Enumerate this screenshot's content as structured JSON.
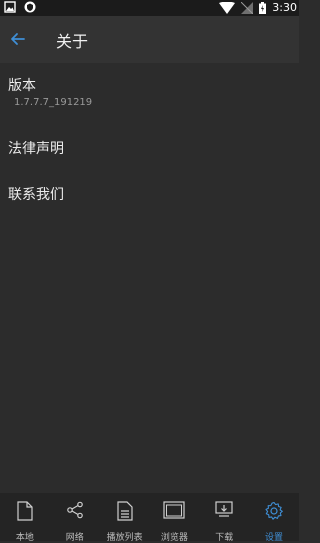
{
  "status_bar": {
    "time": "3:30"
  },
  "header": {
    "title": "关于"
  },
  "items": [
    {
      "title": "版本",
      "subtitle": "1.7.7.7_191219"
    },
    {
      "title": "法律声明"
    },
    {
      "title": "联系我们"
    }
  ],
  "bottom_nav": [
    {
      "label": "本地",
      "icon": "file-icon"
    },
    {
      "label": "网络",
      "icon": "share-icon"
    },
    {
      "label": "播放列表",
      "icon": "list-icon"
    },
    {
      "label": "浏览器",
      "icon": "browser-icon"
    },
    {
      "label": "下载",
      "icon": "download-icon"
    },
    {
      "label": "设置",
      "icon": "gear-icon",
      "active": true
    }
  ],
  "colors": {
    "accent": "#3f8fd6",
    "background": "#2c2c2c",
    "app_bar": "#333333"
  }
}
